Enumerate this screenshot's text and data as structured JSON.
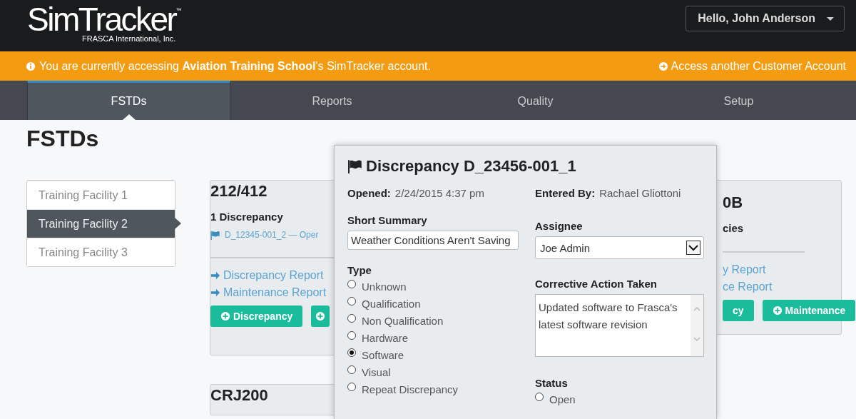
{
  "header": {
    "logo": {
      "name": "SimTracker",
      "trademark": "™",
      "company": "FRASCA International, Inc."
    },
    "user_menu": {
      "greeting": "Hello,",
      "name": "John Anderson"
    }
  },
  "banner": {
    "message": "You are currently accessing **Aviation Training School**'s SimTracker account.",
    "link": "Access another Customer Account"
  },
  "tabs": [
    {
      "label": "FSTDs",
      "selected": true
    },
    {
      "label": "Reports",
      "selected": false
    },
    {
      "label": "Quality",
      "selected": false
    },
    {
      "label": "Setup",
      "selected": false
    }
  ],
  "page_title": "FSTDs",
  "facilities": [
    {
      "label": "Training Facility 1",
      "selected": false
    },
    {
      "label": "Training Facility 2",
      "selected": true
    },
    {
      "label": "Training Facility 3",
      "selected": false
    }
  ],
  "cards": [
    {
      "title": "212/412",
      "subtitle": "1 Discrepancy",
      "discrepancy_link": "D_12345-001_2 — Oper",
      "links": [
        {
          "label": "Discrepancy Report",
          "arrow": true
        },
        {
          "label": "Maintenance Report",
          "arrow": true
        }
      ],
      "buttons": [
        {
          "kind": "icon_text",
          "label": "Discrepancy"
        },
        {
          "kind": "icon"
        }
      ]
    },
    {
      "title": "0B",
      "subtitle": "cies",
      "links": [
        {
          "label": "y Report",
          "arrow": false
        },
        {
          "label": "ce Report",
          "arrow": false
        }
      ],
      "buttons": [
        {
          "kind": "text",
          "label": "cy"
        },
        {
          "kind": "icon_text",
          "label": "Maintenance"
        }
      ]
    },
    {
      "title": "CRJ200"
    }
  ],
  "dialog": {
    "title": "Discrepancy D_23456-001_1",
    "opened": {
      "label": "Opened:",
      "value": "2/24/2015 4:37 pm"
    },
    "entered_by": {
      "label": "Entered By:",
      "value": "Rachael Gliottoni"
    },
    "short_summary": {
      "label": "Short Summary",
      "value": "Weather Conditions Aren't Saving"
    },
    "type": {
      "label": "Type",
      "options": [
        {
          "label": "Unknown",
          "selected": false
        },
        {
          "label": "Qualification",
          "selected": false
        },
        {
          "label": "Non Qualification",
          "selected": false
        },
        {
          "label": "Hardware",
          "selected": false
        },
        {
          "label": "Software",
          "selected": true
        },
        {
          "label": "Visual",
          "selected": false
        },
        {
          "label": "Repeat Discrepancy",
          "selected": false
        }
      ]
    },
    "assignee": {
      "label": "Assignee",
      "value": "Joe Admin"
    },
    "corrective_action": {
      "label": "Corrective Action Taken",
      "value": "Updated software to Frasca's latest software revision"
    },
    "status": {
      "label": "Status",
      "options": [
        {
          "label": "Open",
          "selected": false
        }
      ]
    }
  }
}
